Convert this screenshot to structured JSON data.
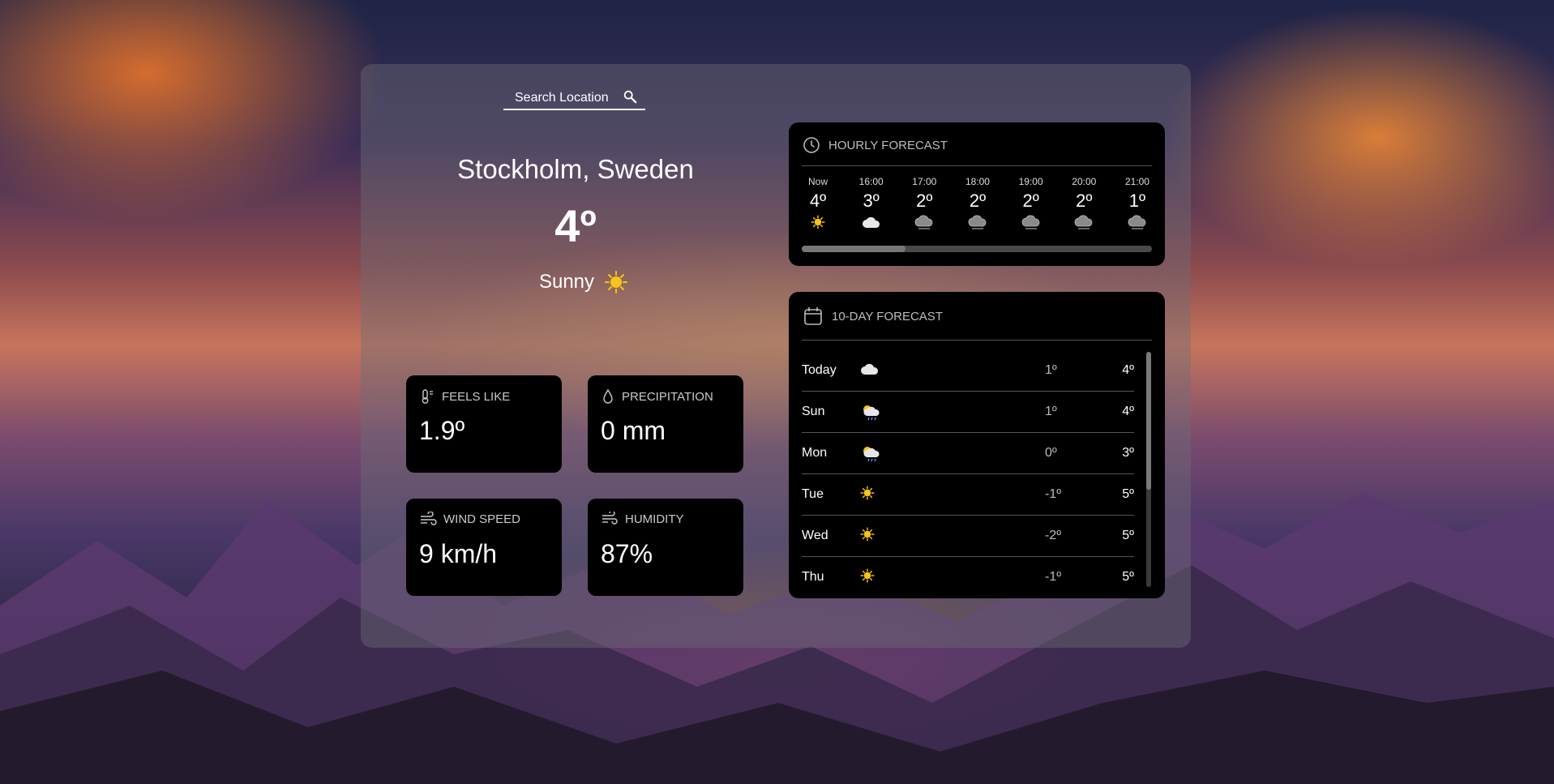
{
  "search": {
    "label": "Search Location"
  },
  "location": {
    "city": "Stockholm, Sweden"
  },
  "current": {
    "temp": "4º",
    "condition": "Sunny"
  },
  "stats": {
    "feels_like": {
      "label": "FEELS LIKE",
      "value": "1.9º"
    },
    "precipitation": {
      "label": "PRECIPITATION",
      "value": "0 mm"
    },
    "wind_speed": {
      "label": "WIND SPEED",
      "value": "9 km/h"
    },
    "humidity": {
      "label": "HUMIDITY",
      "value": "87%"
    }
  },
  "hourly": {
    "title": "HOURLY FORECAST",
    "scroll_position": 0.0,
    "hours": [
      {
        "time": "Now",
        "temp": "4º",
        "icon": "sun-icon"
      },
      {
        "time": "16:00",
        "temp": "3º",
        "icon": "cloud-icon"
      },
      {
        "time": "17:00",
        "temp": "2º",
        "icon": "dark-cloud-icon"
      },
      {
        "time": "18:00",
        "temp": "2º",
        "icon": "dark-cloud-icon"
      },
      {
        "time": "19:00",
        "temp": "2º",
        "icon": "dark-cloud-icon"
      },
      {
        "time": "20:00",
        "temp": "2º",
        "icon": "dark-cloud-icon"
      },
      {
        "time": "21:00",
        "temp": "1º",
        "icon": "dark-cloud-icon"
      }
    ]
  },
  "daily": {
    "title": "10-DAY FORECAST",
    "days": [
      {
        "day": "Today",
        "icon": "cloud-icon",
        "low": "1º",
        "high": "4º"
      },
      {
        "day": "Sun",
        "icon": "sun-rain-cloud-icon",
        "low": "1º",
        "high": "4º"
      },
      {
        "day": "Mon",
        "icon": "sun-rain-cloud-icon",
        "low": "0º",
        "high": "3º"
      },
      {
        "day": "Tue",
        "icon": "sun-icon",
        "low": "-1º",
        "high": "5º"
      },
      {
        "day": "Wed",
        "icon": "sun-icon",
        "low": "-2º",
        "high": "5º"
      },
      {
        "day": "Thu",
        "icon": "sun-icon",
        "low": "-1º",
        "high": "5º"
      }
    ]
  },
  "colors": {
    "card_bg": "#000000",
    "panel_bg": "rgba(110,110,120,0.42)",
    "sun": "#f5c518",
    "text": "#ffffff"
  }
}
